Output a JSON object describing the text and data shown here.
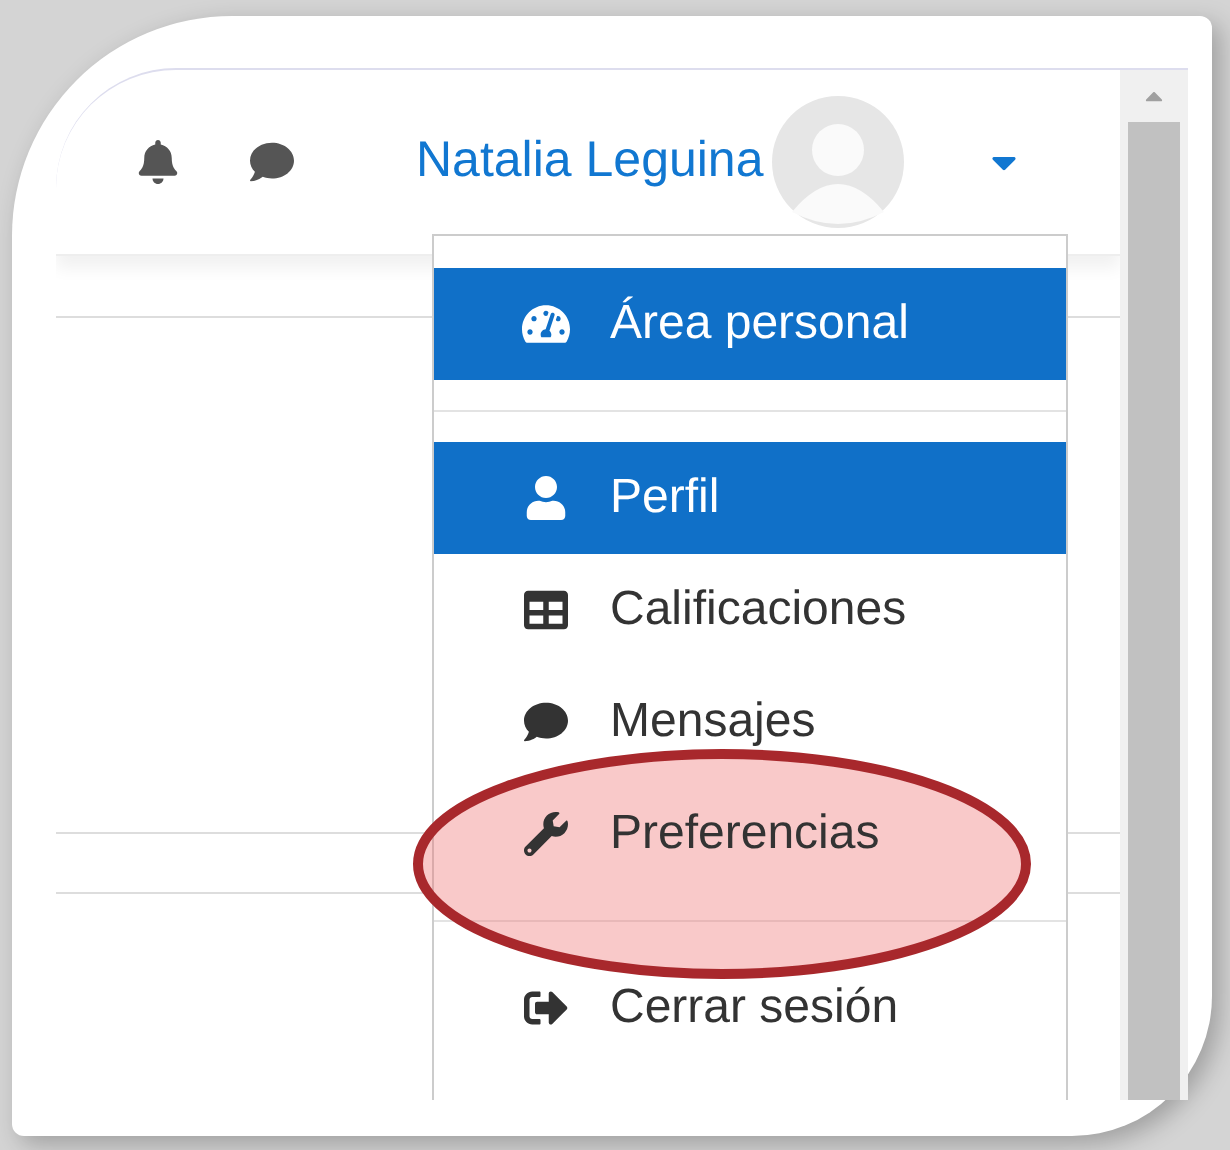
{
  "header": {
    "user_name": "Natalia Leguina"
  },
  "menu": {
    "items": [
      {
        "kind": "item",
        "label": "Área personal",
        "highlighted": true
      },
      {
        "kind": "divider"
      },
      {
        "kind": "item",
        "label": "Perfil",
        "highlighted": true
      },
      {
        "kind": "item",
        "label": "Calificaciones",
        "highlighted": false
      },
      {
        "kind": "item",
        "label": "Mensajes",
        "highlighted": false
      },
      {
        "kind": "item",
        "label": "Preferencias",
        "highlighted": false
      },
      {
        "kind": "divider"
      },
      {
        "kind": "item",
        "label": "Cerrar sesión",
        "highlighted": false
      }
    ]
  },
  "annotation": {
    "kind": "ellipse"
  }
}
